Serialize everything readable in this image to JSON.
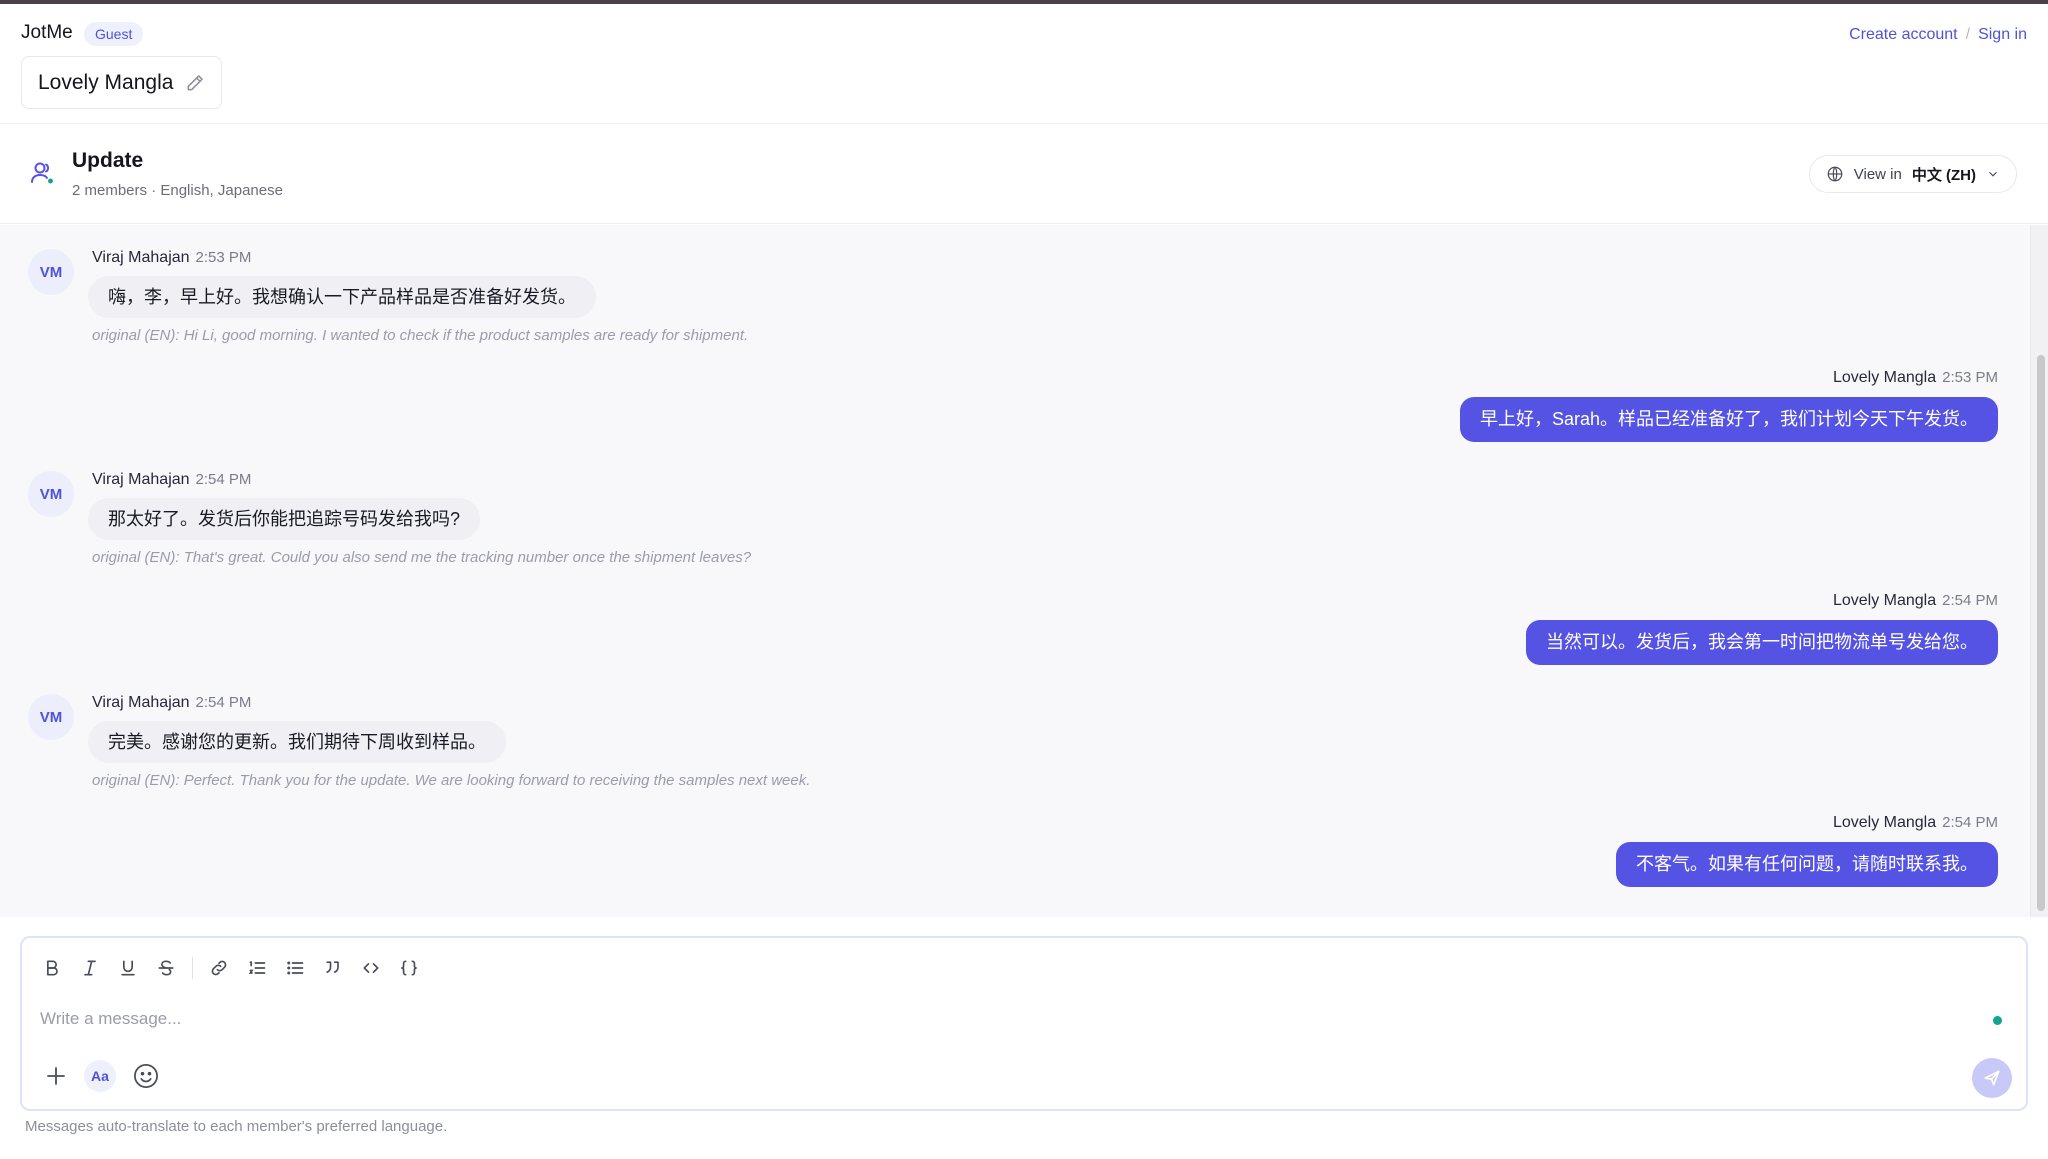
{
  "app": {
    "name": "JotMe",
    "badge": "Guest"
  },
  "auth": {
    "create_account": "Create account",
    "separator": "/",
    "sign_in": "Sign in"
  },
  "user": {
    "display_name": "Lovely Mangla"
  },
  "room": {
    "title": "Update",
    "meta": "2 members · English, Japanese",
    "view_in_label": "View in",
    "view_in_lang": "中文 (ZH)"
  },
  "messages": [
    {
      "direction": "in",
      "avatar": "VM",
      "sender": "Viraj Mahajan",
      "time": "2:53 PM",
      "text": "嗨，李，早上好。我想确认一下产品样品是否准备好发货。",
      "original": "original (EN): Hi Li, good morning. I wanted to check if the product samples are ready for shipment."
    },
    {
      "direction": "out",
      "sender": "Lovely Mangla",
      "time": "2:53 PM",
      "text": "早上好，Sarah。样品已经准备好了，我们计划今天下午发货。"
    },
    {
      "direction": "in",
      "avatar": "VM",
      "sender": "Viraj Mahajan",
      "time": "2:54 PM",
      "text": "那太好了。发货后你能把追踪号码发给我吗?",
      "original": "original (EN): That's great. Could you also send me the tracking number once the shipment leaves?"
    },
    {
      "direction": "out",
      "sender": "Lovely Mangla",
      "time": "2:54 PM",
      "text": "当然可以。发货后，我会第一时间把物流单号发给您。"
    },
    {
      "direction": "in",
      "avatar": "VM",
      "sender": "Viraj Mahajan",
      "time": "2:54 PM",
      "text": "完美。感谢您的更新。我们期待下周收到样品。",
      "original": "original (EN): Perfect. Thank you for the update. We are looking forward to receiving the samples next week."
    },
    {
      "direction": "out",
      "sender": "Lovely Mangla",
      "time": "2:54 PM",
      "text": "不客气。如果有任何问题，请随时联系我。"
    }
  ],
  "composer": {
    "placeholder": "Write a message...",
    "format_label": "Aa",
    "toolbar_icons": [
      "bold-icon",
      "italic-icon",
      "underline-icon",
      "strikethrough-icon",
      "link-icon",
      "ordered-list-icon",
      "bullet-list-icon",
      "blockquote-icon",
      "code-icon",
      "code-block-icon"
    ]
  },
  "footnote": "Messages auto-translate to each member's preferred language.",
  "colors": {
    "accent": "#5553e4",
    "badge_bg": "#eef0fc",
    "link": "#4f53d9",
    "online": "#12a594"
  }
}
